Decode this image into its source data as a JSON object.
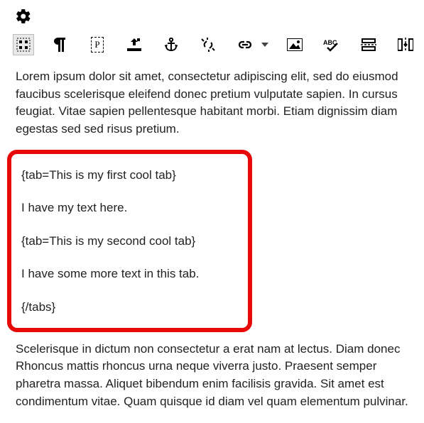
{
  "toolbar": {
    "settings_icon": "settings",
    "buttons": [
      {
        "name": "select-block-button",
        "icon": "select-block"
      },
      {
        "name": "paragraph-mark-button",
        "icon": "pilcrow"
      },
      {
        "name": "paragraph-style-button",
        "icon": "p-letter"
      },
      {
        "name": "upload-button",
        "icon": "upload"
      },
      {
        "name": "anchor-button",
        "icon": "anchor"
      },
      {
        "name": "unlink-button",
        "icon": "unlink"
      },
      {
        "name": "link-button",
        "icon": "link"
      },
      {
        "name": "link-dropdown",
        "icon": "dropdown"
      },
      {
        "name": "image-button",
        "icon": "image"
      },
      {
        "name": "spellcheck-button",
        "icon": "spellcheck"
      },
      {
        "name": "cut-row-button",
        "icon": "cut-row"
      },
      {
        "name": "insert-column-button",
        "icon": "insert-column"
      }
    ]
  },
  "content": {
    "para1": "Lorem ipsum dolor sit amet, consectetur adipiscing elit, sed do eiusmod faucibus scelerisque eleifend donec pretium vulputate sapien. In cursus feugiat. Vitae sapien pellentesque habitant morbi. Etiam dignissim diam egestas sed sed risus pretium.",
    "tab_block": {
      "line1": "{tab=This is my first cool tab}",
      "line2": "I have my text here.",
      "line3": "{tab=This is my second cool tab}",
      "line4": "I have some more text in this tab.",
      "line5": "{/tabs}"
    },
    "para2": "Scelerisque in dictum non consectetur a erat nam at lectus. Diam donec Rhoncus mattis rhoncus urna neque viverra justo. Praesent semper pharetra massa. Aliquet bibendum enim facilisis gravida. Sit amet est condimentum vitae. Quam quisque id diam vel quam elementum pulvinar."
  }
}
